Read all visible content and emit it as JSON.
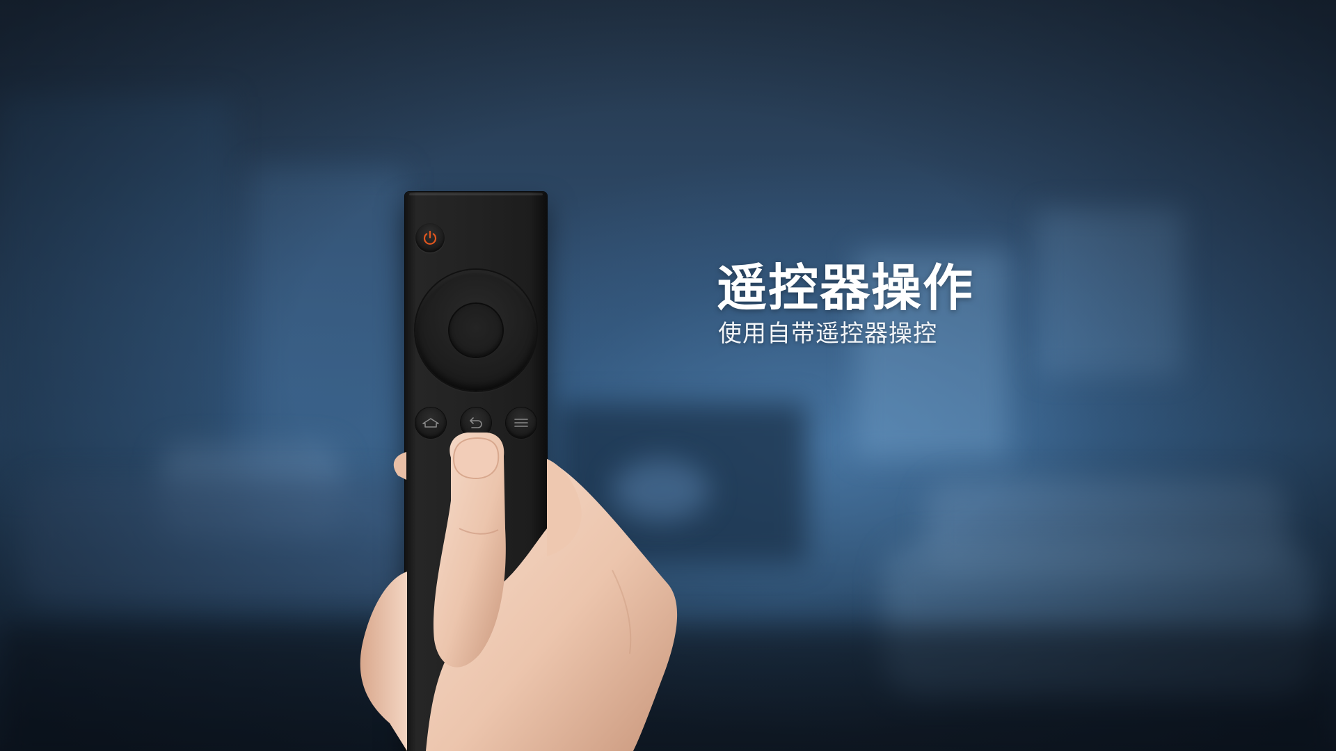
{
  "headline": {
    "title": "遥控器操作",
    "subtitle": "使用自带遥控器操控"
  },
  "remote": {
    "buttons": [
      {
        "icon": "power-icon"
      },
      {
        "icon": "dpad"
      },
      {
        "icon": "ok-button"
      },
      {
        "icon": "home-icon"
      },
      {
        "icon": "back-icon"
      },
      {
        "icon": "menu-icon"
      }
    ]
  },
  "colors": {
    "power_accent": "#e2561e",
    "text": "#ffffff",
    "background_blue": "#2f4c6c"
  }
}
